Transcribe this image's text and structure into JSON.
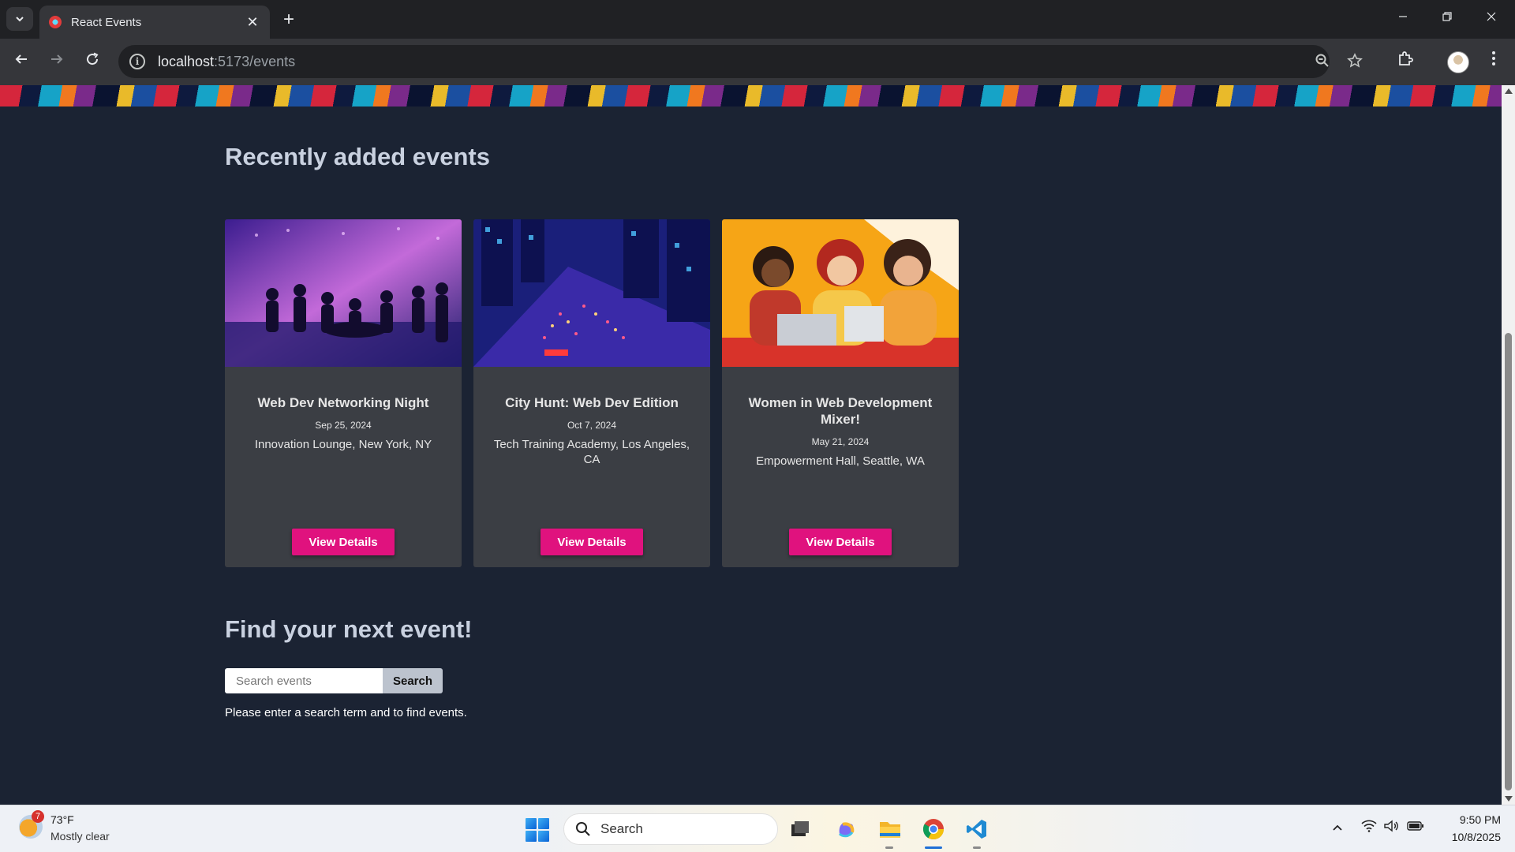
{
  "browser": {
    "tab_title": "React Events",
    "url_host": "localhost",
    "url_path": ":5173/events",
    "new_tab_symbol": "+",
    "close_symbol": "✕"
  },
  "page": {
    "recent_title": "Recently added events",
    "find_title": "Find your next event!",
    "events": [
      {
        "title": "Web Dev Networking Night",
        "date": "Sep 25, 2024",
        "location": "Innovation Lounge, New York, NY",
        "button": "View Details"
      },
      {
        "title": "City Hunt: Web Dev Edition",
        "date": "Oct 7, 2024",
        "location": "Tech Training Academy, Los Angeles, CA",
        "button": "View Details"
      },
      {
        "title": "Women in Web Development Mixer!",
        "date": "May 21, 2024",
        "location": "Empowerment Hall, Seattle, WA",
        "button": "View Details"
      }
    ],
    "search": {
      "placeholder": "Search events",
      "button": "Search",
      "hint": "Please enter a search term and to find events."
    }
  },
  "taskbar": {
    "weather_badge": "7",
    "weather_temp": "73°F",
    "weather_desc": "Mostly clear",
    "search_label": "Search",
    "time": "9:50 PM",
    "date": "10/8/2025"
  },
  "colors": {
    "page_bg": "#1b2333",
    "card_bg": "#3b3e44",
    "accent_button": "#e0127e",
    "heading": "#c9d1e0"
  }
}
